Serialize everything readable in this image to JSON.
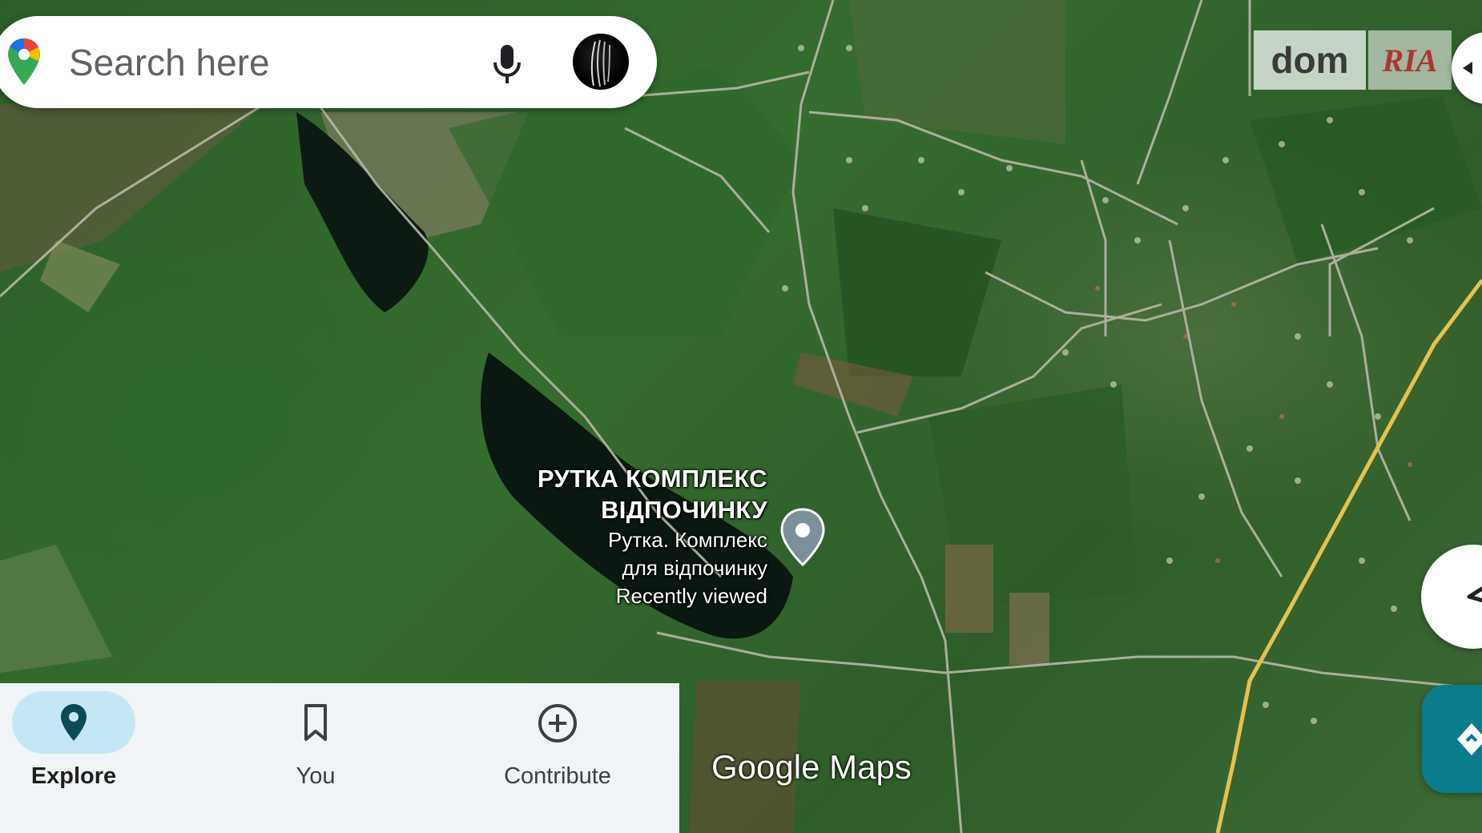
{
  "search": {
    "placeholder": "Search here"
  },
  "watermark": {
    "brand_left": "dom",
    "brand_right": "RIA"
  },
  "place": {
    "title_line1": "РУТКА КОМПЛЕКС",
    "title_line2": "ВІДПОЧИНКУ",
    "subtitle_line1": "Рутка. Комплекс",
    "subtitle_line2": "для відпочинку",
    "status": "Recently viewed"
  },
  "map_attribution": "Google Maps",
  "bottom_nav": {
    "items": [
      {
        "label": "Explore",
        "icon": "location-pin-icon",
        "active": true
      },
      {
        "label": "You",
        "icon": "bookmark-icon",
        "active": false
      },
      {
        "label": "Contribute",
        "icon": "add-circle-icon",
        "active": false
      }
    ]
  },
  "colors": {
    "accent": "#c3e8f3",
    "directions": "#0a7d8c",
    "nav_background": "#f1f4f6"
  }
}
